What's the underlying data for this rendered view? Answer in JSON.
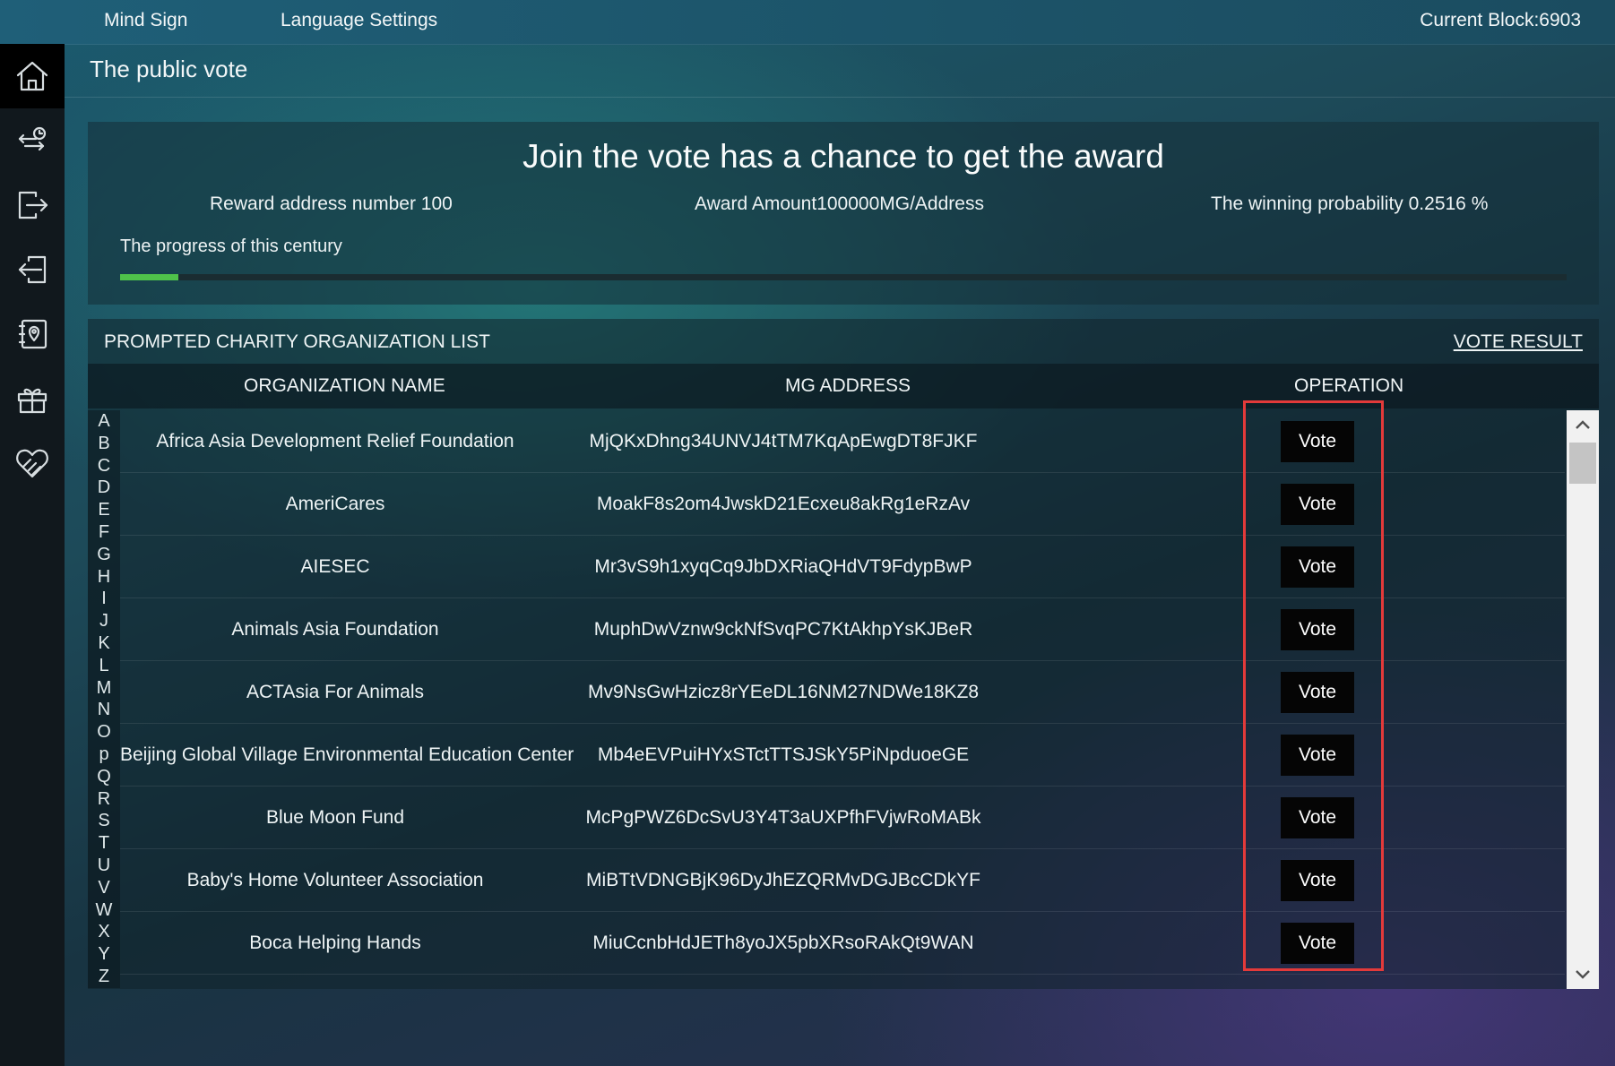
{
  "topbar": {
    "menu_mind_sign": "Mind Sign",
    "menu_language": "Language Settings",
    "current_block": "Current Block:6903"
  },
  "sidebar": {
    "items": [
      {
        "icon": "home-icon"
      },
      {
        "icon": "transfer-history-icon"
      },
      {
        "icon": "send-icon"
      },
      {
        "icon": "receive-icon"
      },
      {
        "icon": "address-book-icon"
      },
      {
        "icon": "gift-icon"
      },
      {
        "icon": "charity-heart-icon"
      }
    ]
  },
  "page": {
    "title": "The public vote"
  },
  "award": {
    "headline": "Join the vote has a chance to get the award",
    "reward_address": "Reward address number 100",
    "award_amount": "Award Amount100000MG/Address",
    "winning_probability": "The winning probability 0.2516 %",
    "progress_label": "The progress of this century",
    "progress_fraction": 0.04
  },
  "list": {
    "title": "PROMPTED CHARITY ORGANIZATION LIST",
    "vote_result_link": "VOTE RESULT",
    "columns": [
      "ORGANIZATION NAME",
      "MG ADDRESS",
      "OPERATION"
    ],
    "alphabet": [
      "A",
      "B",
      "C",
      "D",
      "E",
      "F",
      "G",
      "H",
      "I",
      "J",
      "K",
      "L",
      "M",
      "N",
      "O",
      "p",
      "Q",
      "R",
      "S",
      "T",
      "U",
      "V",
      "W",
      "X",
      "Y",
      "Z"
    ],
    "rows": [
      {
        "name": "Africa Asia Development Relief Foundation",
        "address": "MjQKxDhng34UNVJ4tTM7KqApEwgDT8FJKF",
        "action": "Vote"
      },
      {
        "name": "AmeriCares",
        "address": "MoakF8s2om4JwskD21Ecxeu8akRg1eRzAv",
        "action": "Vote"
      },
      {
        "name": "AIESEC",
        "address": "Mr3vS9h1xyqCq9JbDXRiaQHdVT9FdypBwP",
        "action": "Vote"
      },
      {
        "name": "Animals Asia Foundation",
        "address": "MuphDwVznw9ckNfSvqPC7KtAkhpYsKJBeR",
        "action": "Vote"
      },
      {
        "name": "ACTAsia For Animals",
        "address": "Mv9NsGwHzicz8rYEeDL16NM27NDWe18KZ8",
        "action": "Vote"
      },
      {
        "name": "Beijing Global Village Environmental Education Center",
        "address": "Mb4eEVPuiHYxSTctTTSJSkY5PiNpduoeGE",
        "action": "Vote"
      },
      {
        "name": "Blue Moon Fund",
        "address": "McPgPWZ6DcSvU3Y4T3aUXPfhFVjwRoMABk",
        "action": "Vote"
      },
      {
        "name": "Baby's Home Volunteer Association",
        "address": "MiBTtVDNGBjK96DyJhEZQRMvDGJBcCDkYF",
        "action": "Vote"
      },
      {
        "name": "Boca Helping Hands",
        "address": "MiuCcnbHdJETh8yoJX5pbXRsoRAkQt9WAN",
        "action": "Vote"
      }
    ]
  },
  "colors": {
    "progress_fill": "#4fc24a",
    "highlight_border": "#e33a3a",
    "vote_button_bg": "#050505"
  }
}
